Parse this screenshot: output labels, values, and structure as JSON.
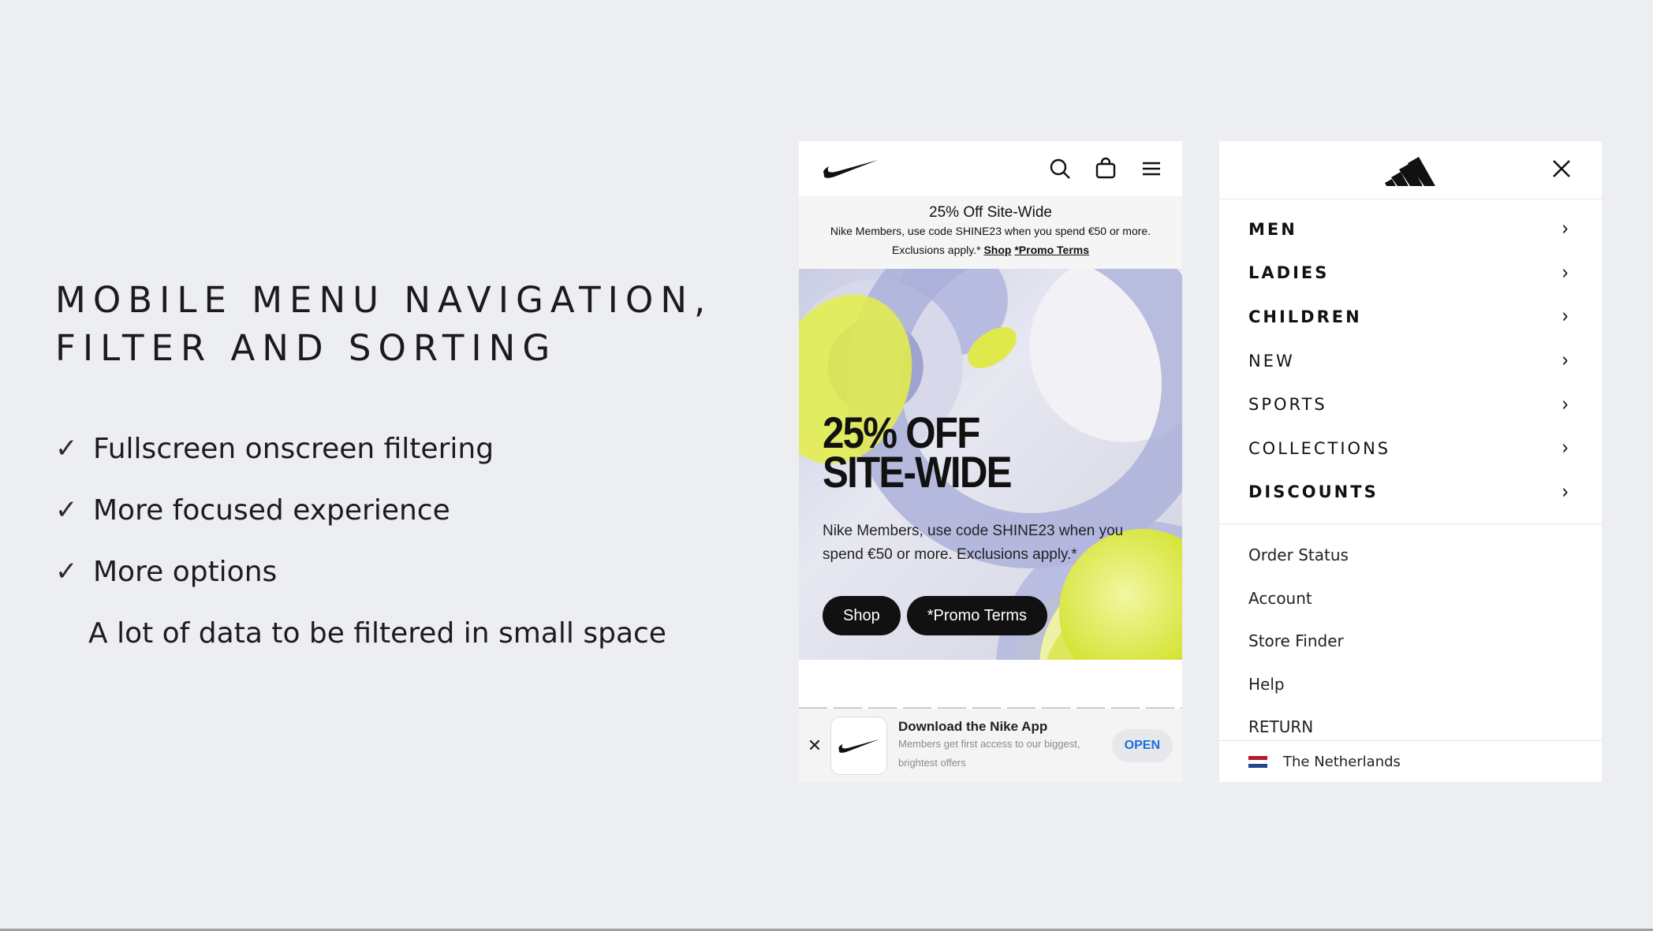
{
  "slide": {
    "title_line1": "MOBILE MENU NAVIGATION,",
    "title_line2": "FILTER AND SORTING",
    "bullets": [
      {
        "check": "✓",
        "text": "Fullscreen onscreen filtering"
      },
      {
        "check": "✓",
        "text": "More focused experience"
      },
      {
        "check": "✓",
        "text": "More options"
      }
    ],
    "note": "A lot of data to be filtered in small space"
  },
  "nike": {
    "promo": {
      "title": "25% Off Site-Wide",
      "line2": "Nike Members, use code SHINE23 when you spend €50 or more.",
      "line3_prefix": "Exclusions apply.*",
      "shop_link": "Shop",
      "terms_link": "*Promo Terms"
    },
    "hero": {
      "headline_1": "25% OFF",
      "headline_2": "SITE-WIDE",
      "copy": "Nike Members, use code SHINE23 when you spend €50 or more. Exclusions apply.*",
      "button_shop": "Shop",
      "button_terms": "*Promo Terms"
    },
    "app_banner": {
      "close": "✕",
      "title": "Download the Nike App",
      "subtitle": "Members get first access to our biggest, brightest offers",
      "open": "OPEN"
    },
    "icons": [
      "nike-logo",
      "search-icon",
      "bag-icon",
      "menu-icon"
    ]
  },
  "adidas": {
    "menu": [
      {
        "label": "MEN",
        "bold": true
      },
      {
        "label": "LADIES",
        "bold": true
      },
      {
        "label": "CHILDREN",
        "bold": true
      },
      {
        "label": "NEW",
        "bold": false
      },
      {
        "label": "SPORTS",
        "bold": false
      },
      {
        "label": "COLLECTIONS",
        "bold": false
      },
      {
        "label": "DISCOUNTS",
        "bold": true
      }
    ],
    "links": [
      "Order Status",
      "Account",
      "Store Finder",
      "Help",
      "RETURN"
    ],
    "country": "The Netherlands",
    "flag_colors": [
      "#ae1c28",
      "#ffffff",
      "#21468b"
    ],
    "icons": [
      "adidas-logo",
      "close-icon",
      "chevron-right-icon"
    ]
  }
}
